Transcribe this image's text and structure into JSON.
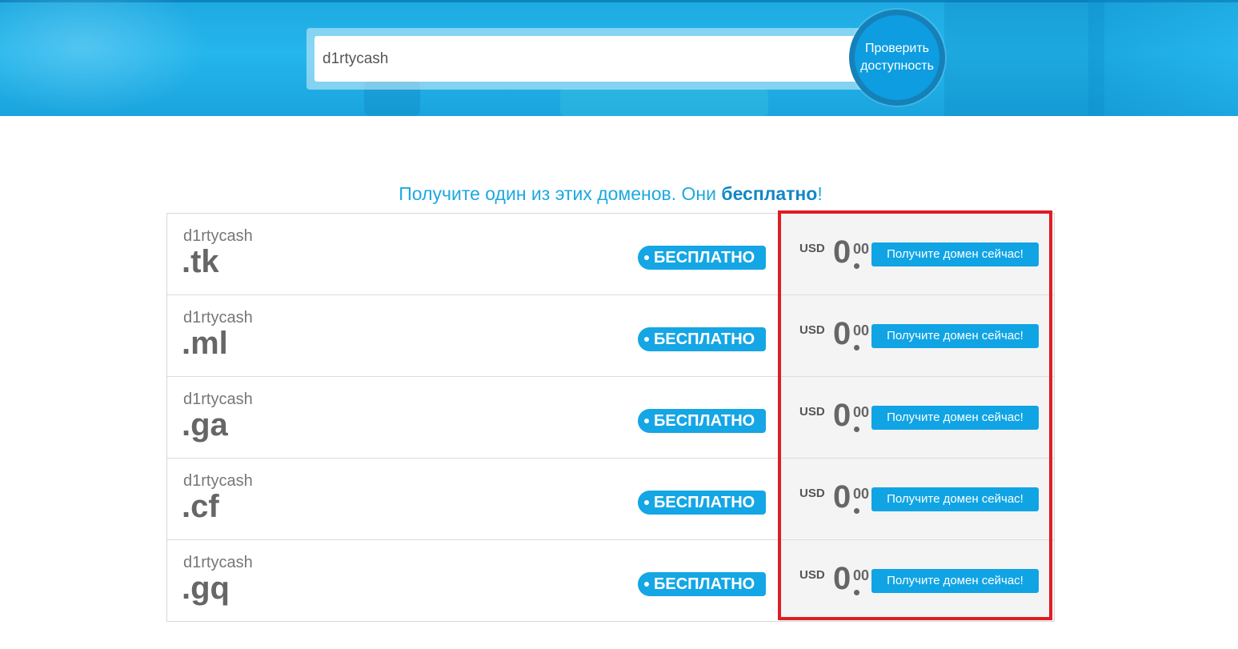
{
  "search": {
    "value": "d1rtycash",
    "button_line1": "Проверить",
    "button_line2": "доступность"
  },
  "heading": {
    "prefix": "Получите один из этих доменов. Они ",
    "bold": "бесплатно",
    "suffix": "!"
  },
  "rows": [
    {
      "sld": "d1rtycash",
      "tld": ".tk",
      "badge": "БЕСПЛАТНО",
      "currency": "USD",
      "price_whole": "0",
      "price_cents": "00",
      "button": "Получите домен сейчас!"
    },
    {
      "sld": "d1rtycash",
      "tld": ".ml",
      "badge": "БЕСПЛАТНО",
      "currency": "USD",
      "price_whole": "0",
      "price_cents": "00",
      "button": "Получите домен сейчас!"
    },
    {
      "sld": "d1rtycash",
      "tld": ".ga",
      "badge": "БЕСПЛАТНО",
      "currency": "USD",
      "price_whole": "0",
      "price_cents": "00",
      "button": "Получите домен сейчас!"
    },
    {
      "sld": "d1rtycash",
      "tld": ".cf",
      "badge": "БЕСПЛАТНО",
      "currency": "USD",
      "price_whole": "0",
      "price_cents": "00",
      "button": "Получите домен сейчас!"
    },
    {
      "sld": "d1rtycash",
      "tld": ".gq",
      "badge": "БЕСПЛАТНО",
      "currency": "USD",
      "price_whole": "0",
      "price_cents": "00",
      "button": "Получите домен сейчас!"
    }
  ],
  "colors": {
    "accent": "#14a6e5",
    "highlight": "#e01c24"
  }
}
